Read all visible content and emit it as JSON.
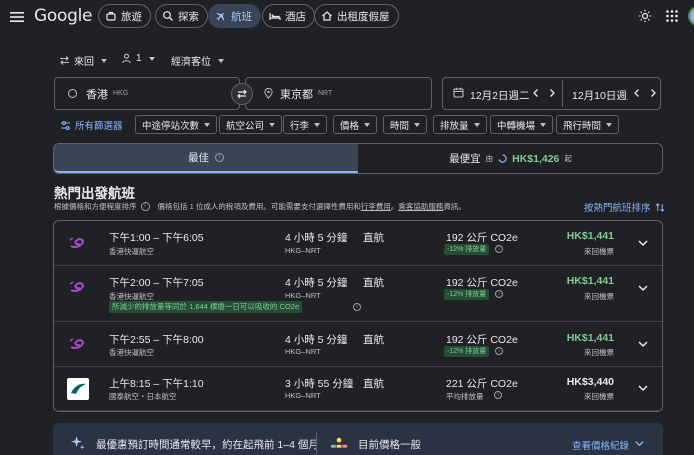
{
  "header": {
    "logo": "Google",
    "nav": [
      {
        "label": "旅遊",
        "icon": "travel-icon"
      },
      {
        "label": "探索",
        "icon": "explore-icon"
      },
      {
        "label": "航班",
        "icon": "flight-icon",
        "active": true
      },
      {
        "label": "酒店",
        "icon": "hotel-icon"
      },
      {
        "label": "出租度假屋",
        "icon": "vacation-rental-icon"
      }
    ]
  },
  "search": {
    "trip_type": "來回",
    "passengers": "1",
    "cabin": "經濟客位",
    "origin": {
      "city": "香港",
      "code": "HKG"
    },
    "destination": {
      "city": "東京都",
      "code": "NRT"
    },
    "depart_date": "12月2日週二",
    "return_date": "12月10日週三"
  },
  "filters": {
    "all_label": "所有篩選器",
    "chips": [
      "中途停站次數",
      "航空公司",
      "行李",
      "價格",
      "時間",
      "排放量",
      "中轉機場",
      "飛行時間"
    ]
  },
  "tabs": {
    "best": "最佳",
    "cheapest": "最便宜",
    "cheapest_from": "由",
    "cheapest_price": "HK$1,426",
    "cheapest_suffix": "起"
  },
  "section": {
    "title": "熱門出發航班",
    "subtitle_1": "根據價格和方便程度排序",
    "subtitle_2": "價格包括 1 位成人的稅項及費用。可能需要支付選擇性費用和",
    "subtitle_link1": "行李費用",
    "subtitle_3": "。",
    "subtitle_link2": "乘客協助服務",
    "subtitle_4": "資訊。",
    "sort_label": "按熱門航班排序"
  },
  "flights": [
    {
      "times": "下午1:00 – 下午6:05",
      "airline": "香港快運航空",
      "duration": "4 小時 5 分鐘",
      "route": "HKG–NRT",
      "stops": "直航",
      "emissions": "192 公斤 CO2e",
      "emissions_note": "-12% 排放量",
      "price": "HK$1,441",
      "price_type": "來回機票",
      "note": ""
    },
    {
      "times": "下午2:00 – 下午7:05",
      "airline": "香港快運航空",
      "duration": "4 小時 5 分鐘",
      "route": "HKG–NRT",
      "stops": "直航",
      "emissions": "192 公斤 CO2e",
      "emissions_note": "-12% 排放量",
      "price": "HK$1,441",
      "price_type": "來回機票",
      "note": "所減少的排放量等同於 1,644 棵樹一日可以吸收的 CO2e"
    },
    {
      "times": "下午2:55 – 下午8:00",
      "airline": "香港快運航空",
      "duration": "4 小時 5 分鐘",
      "route": "HKG–NRT",
      "stops": "直航",
      "emissions": "192 公斤 CO2e",
      "emissions_note": "-12% 排放量",
      "price": "HK$1,441",
      "price_type": "來回機票",
      "note": ""
    },
    {
      "times": "上午8:15 – 下午1:10",
      "airline": "國泰航空・日本航空",
      "duration": "3 小時 55 分鐘",
      "route": "HKG–NRT",
      "stops": "直航",
      "emissions": "221 公斤 CO2e",
      "emissions_note": "平均排放量",
      "price": "HK$3,440",
      "price_type": "來回機票",
      "note": ""
    }
  ],
  "banner": {
    "tip": "最優惠預訂時間通常較早，約在起飛前 1–4 個月",
    "price_level": "目前價格一般",
    "history_link": "查看價格紀錄"
  },
  "colors": {
    "background": "#202124",
    "accent": "#8ab4f8",
    "green": "#81c995",
    "hk_express": "#702082",
    "cathay": "#006564"
  }
}
